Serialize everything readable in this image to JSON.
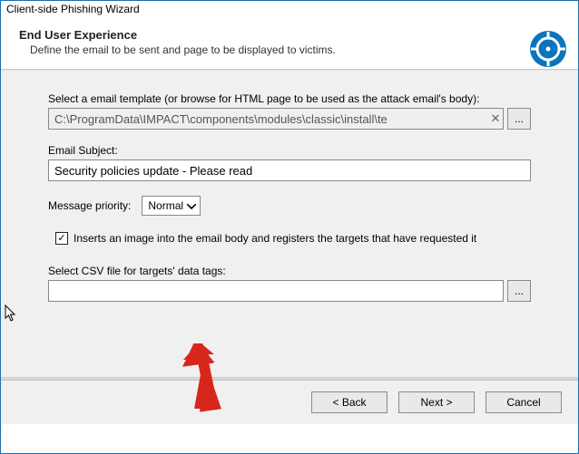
{
  "window": {
    "title": "Client-side Phishing Wizard"
  },
  "header": {
    "title": "End User Experience",
    "subtitle": "Define the email to be sent and page to be displayed to victims."
  },
  "template": {
    "label": "Select a email template (or browse for HTML page to be used as the attack email's body):",
    "value": "C:\\ProgramData\\IMPACT\\components\\modules\\classic\\install\\te",
    "browse": "..."
  },
  "subject": {
    "label": "Email Subject:",
    "value": "Security policies update - Please read"
  },
  "priority": {
    "label": "Message priority:",
    "value": "Normal"
  },
  "imageTrack": {
    "checked": true,
    "label": "Inserts an image into the email body and registers the targets that have requested it"
  },
  "csv": {
    "label": "Select CSV file for targets' data tags:",
    "value": "",
    "browse": "..."
  },
  "footer": {
    "back": "< Back",
    "next": "Next >",
    "cancel": "Cancel"
  }
}
